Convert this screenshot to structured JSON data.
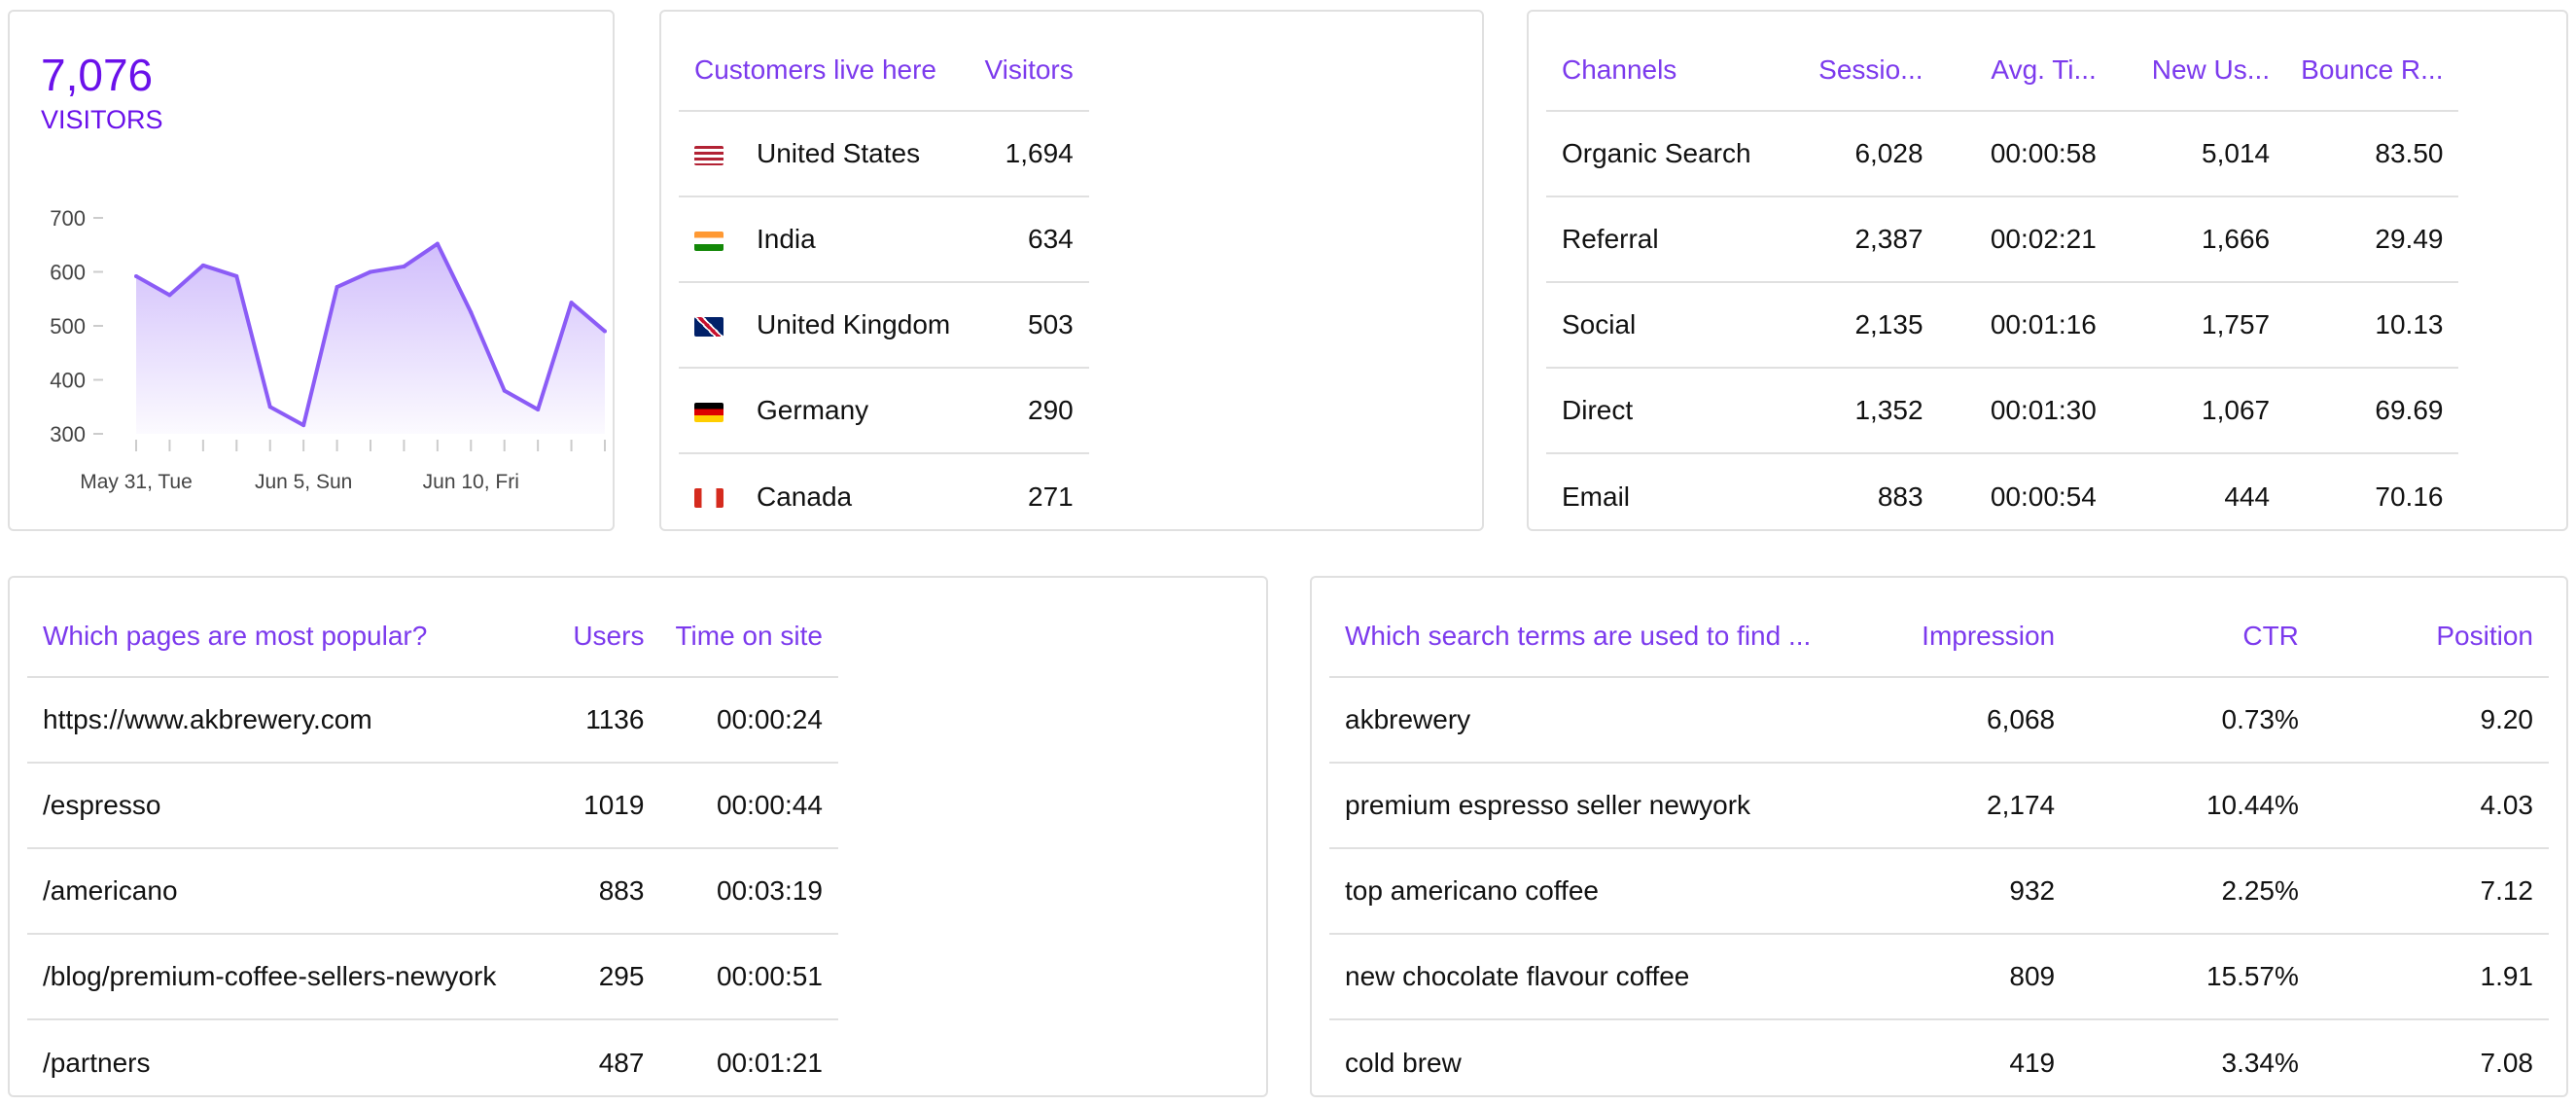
{
  "visitors": {
    "total": "7,076",
    "label": "VISITORS",
    "accent": "#6a11ea"
  },
  "chart_data": {
    "type": "area",
    "x": [
      "May 31, Tue",
      "Jun 1",
      "Jun 2",
      "Jun 3",
      "Jun 4",
      "Jun 5, Sun",
      "Jun 6",
      "Jun 7",
      "Jun 8",
      "Jun 9",
      "Jun 10, Fri",
      "Jun 11",
      "Jun 12",
      "Jun 13",
      "Jun 14"
    ],
    "values": [
      592,
      557,
      612,
      592,
      350,
      316,
      572,
      600,
      610,
      652,
      525,
      380,
      345,
      543,
      490
    ],
    "x_tick_labels": [
      "May 31, Tue",
      "Jun 5, Sun",
      "Jun 10, Fri"
    ],
    "y_ticks": [
      "700",
      "600",
      "500",
      "400",
      "300"
    ],
    "ylim": [
      300,
      700
    ],
    "color": "#8b5cf6",
    "grid": false
  },
  "countries": {
    "headers": [
      "Customers live here",
      "Visitors"
    ],
    "rows": [
      {
        "name": "United States",
        "value": "1,694",
        "flag": "us"
      },
      {
        "name": "India",
        "value": "634",
        "flag": "in"
      },
      {
        "name": "United Kingdom",
        "value": "503",
        "flag": "gb"
      },
      {
        "name": "Germany",
        "value": "290",
        "flag": "de"
      },
      {
        "name": "Canada",
        "value": "271",
        "flag": "ca"
      }
    ]
  },
  "channels": {
    "headers": [
      "Channels",
      "Sessio...",
      "Avg. Ti...",
      "New Us...",
      "Bounce R..."
    ],
    "rows": [
      [
        "Organic Search",
        "6,028",
        "00:00:58",
        "5,014",
        "83.50"
      ],
      [
        "Referral",
        "2,387",
        "00:02:21",
        "1,666",
        "29.49"
      ],
      [
        "Social",
        "2,135",
        "00:01:16",
        "1,757",
        "10.13"
      ],
      [
        "Direct",
        "1,352",
        "00:01:30",
        "1,067",
        "69.69"
      ],
      [
        "Email",
        "883",
        "00:00:54",
        "444",
        "70.16"
      ]
    ]
  },
  "pages": {
    "headers": [
      "Which pages are most popular?",
      "Users",
      "Time on site"
    ],
    "rows": [
      [
        "https://www.akbrewery.com",
        "1136",
        "00:00:24"
      ],
      [
        "/espresso",
        "1019",
        "00:00:44"
      ],
      [
        "/americano",
        "883",
        "00:03:19"
      ],
      [
        "/blog/premium-coffee-sellers-newyork",
        "295",
        "00:00:51"
      ],
      [
        "/partners",
        "487",
        "00:01:21"
      ]
    ]
  },
  "search": {
    "headers": [
      "Which search terms are used to find ...",
      "Impression",
      "CTR",
      "Position"
    ],
    "rows": [
      [
        "akbrewery",
        "6,068",
        "0.73%",
        "9.20"
      ],
      [
        "premium espresso seller newyork",
        "2,174",
        "10.44%",
        "4.03"
      ],
      [
        "top americano coffee",
        "932",
        "2.25%",
        "7.12"
      ],
      [
        "new chocolate flavour coffee",
        "809",
        "15.57%",
        "1.91"
      ],
      [
        "cold brew",
        "419",
        "3.34%",
        "7.08"
      ]
    ]
  }
}
